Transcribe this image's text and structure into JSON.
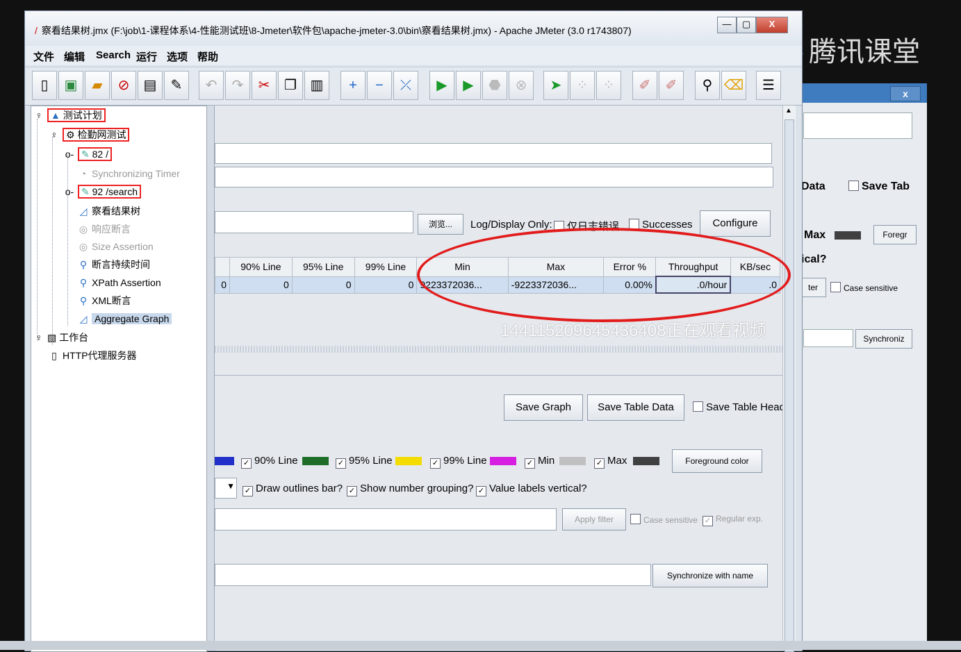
{
  "brand": "腾讯课堂",
  "background_window": {
    "close_label": "x",
    "data_label": "Data",
    "save_tab_label": "Save Tab",
    "max_label": "Max",
    "foreg_label": "Foregr",
    "ical_label": "ical?",
    "ter_label": "ter",
    "case_sensitive_label": "Case sensitive",
    "synchroniz_label": "Synchroniz"
  },
  "window": {
    "title": "察看结果树.jmx (F:\\job\\1-课程体系\\4-性能测试班\\8-Jmeter\\软件包\\apache-jmeter-3.0\\bin\\察看结果树.jmx) - Apache JMeter (3.0 r1743807)",
    "minimize_label": "—",
    "maximize_label": "▢",
    "close_label": "X"
  },
  "menu": [
    "文件",
    "编辑",
    "Search",
    "运行",
    "选项",
    "帮助"
  ],
  "tree": {
    "test_plan": "测试计划",
    "thread_group": "检勤网测试",
    "sampler_82": "82 /",
    "sync_timer": "Synchronizing Timer",
    "sampler_92": "92 /search",
    "view_results_tree": "察看结果树",
    "response_assertion": "响应断言",
    "size_assertion": "Size Assertion",
    "duration_assertion": "断言持续时间",
    "xpath_assertion": "XPath Assertion",
    "xml_assertion": "XML断言",
    "aggregate_graph": "Aggregate Graph",
    "workbench": "工作台",
    "http_proxy": "HTTP代理服务器"
  },
  "panel": {
    "browse_label": "浏览...",
    "log_display_label": "Log/Display Only:",
    "errors_only_label": "仅日志错误",
    "successes_label": "Successes",
    "configure_label": "Configure",
    "table": {
      "headers": [
        "90% Line",
        "95% Line",
        "99% Line",
        "Min",
        "Max",
        "Error %",
        "Throughput",
        "KB/sec"
      ],
      "row": [
        "0",
        "0",
        "0",
        "0",
        "9223372036...",
        "-9223372036...",
        "0.00%",
        ".0/hour",
        ".0"
      ]
    },
    "save_graph_label": "Save Graph",
    "save_table_data_label": "Save Table Data",
    "save_table_header_label": "Save Table Header",
    "series": [
      {
        "label": "90% Line",
        "color": "#1e6e2a"
      },
      {
        "label": "95% Line",
        "color": "#f4dc00"
      },
      {
        "label": "99% Line",
        "color": "#d61fe0"
      },
      {
        "label": "Min",
        "color": "#c0c0c0"
      },
      {
        "label": "Max",
        "color": "#404040"
      }
    ],
    "foreground_color_label": "Foreground color",
    "draw_outlines_label": "Draw outlines bar?",
    "number_grouping_label": "Show number grouping?",
    "labels_vertical_label": "Value labels vertical?",
    "apply_filter_label": "Apply filter",
    "case_sensitive_label": "Case sensitive",
    "regular_exp_label": "Regular exp.",
    "sync_with_name_label": "Synchronize with name"
  },
  "watermark": "1441152096454364​08正在观看视频"
}
